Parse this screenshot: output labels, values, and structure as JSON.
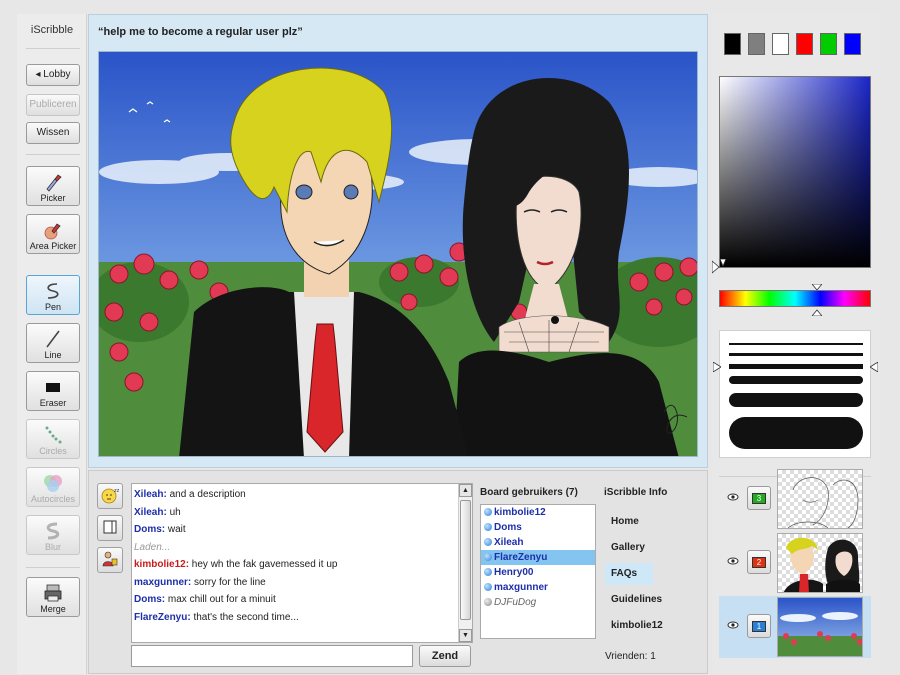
{
  "app": {
    "name": "iScribble"
  },
  "toolbar": {
    "lobby_label": "◂ Lobby",
    "publish_label": "Publiceren",
    "clear_label": "Wissen",
    "tools": [
      {
        "label": "Picker",
        "icon": "eyedropper-icon"
      },
      {
        "label": "Area Picker",
        "icon": "area-picker-icon"
      },
      {
        "label": "Pen",
        "icon": "pen-icon",
        "active": true
      },
      {
        "label": "Line",
        "icon": "line-icon"
      },
      {
        "label": "Eraser",
        "icon": "eraser-icon"
      },
      {
        "label": "Circles",
        "icon": "circles-icon",
        "disabled": true
      },
      {
        "label": "Autocircles",
        "icon": "autocircles-icon",
        "disabled": true
      },
      {
        "label": "Blur",
        "icon": "blur-icon",
        "disabled": true
      },
      {
        "label": "Merge",
        "icon": "merge-icon"
      }
    ]
  },
  "board": {
    "title": "“help me to become a regular user plz”"
  },
  "chat": {
    "messages": [
      {
        "nick": "Xileah:",
        "text": " and a description",
        "nick_color": "blue"
      },
      {
        "nick": "Xileah:",
        "text": " uh",
        "nick_color": "blue"
      },
      {
        "nick": "Doms:",
        "text": " wait",
        "nick_color": "blue"
      },
      {
        "nick": "",
        "text": "Laden...",
        "system": true
      },
      {
        "nick": "kimbolie12:",
        "text": " hey wh the fak gavemessed it up",
        "nick_color": "red"
      },
      {
        "nick": "maxgunner:",
        "text": " sorry for the line",
        "nick_color": "blue"
      },
      {
        "nick": "Doms:",
        "text": " max chill out for a minuit",
        "nick_color": "blue"
      },
      {
        "nick": "FlareZenyu:",
        "text": " that's the second time...",
        "nick_color": "blue"
      }
    ],
    "input_value": "",
    "send_label": "Zend"
  },
  "users": {
    "title": "Board gebruikers (7)",
    "list": [
      {
        "name": "kimbolie12"
      },
      {
        "name": "Doms"
      },
      {
        "name": "Xileah"
      },
      {
        "name": "FlareZenyu",
        "selected": true
      },
      {
        "name": "Henry00"
      },
      {
        "name": "maxgunner"
      },
      {
        "name": "DJFuDog",
        "idle": true
      }
    ]
  },
  "info": {
    "title": "iScribble Info",
    "links": [
      "Home",
      "Gallery",
      "FAQs",
      "Guidelines",
      "kimbolie12"
    ],
    "active_link": "FAQs",
    "friends": "Vrienden: 1"
  },
  "palette": {
    "swatches": [
      "#000000",
      "#7f7f7f",
      "#ffffff",
      "#ff0000",
      "#00cc00",
      "#0000ff"
    ],
    "current_hue": "#1b26c9"
  },
  "layers": [
    {
      "number": "3",
      "badge_color": "#22aa22",
      "thumb": "sketch"
    },
    {
      "number": "2",
      "badge_color": "#dd3311",
      "thumb": "characters"
    },
    {
      "number": "1",
      "badge_color": "#2a7fd4",
      "thumb": "background",
      "active": true
    }
  ]
}
